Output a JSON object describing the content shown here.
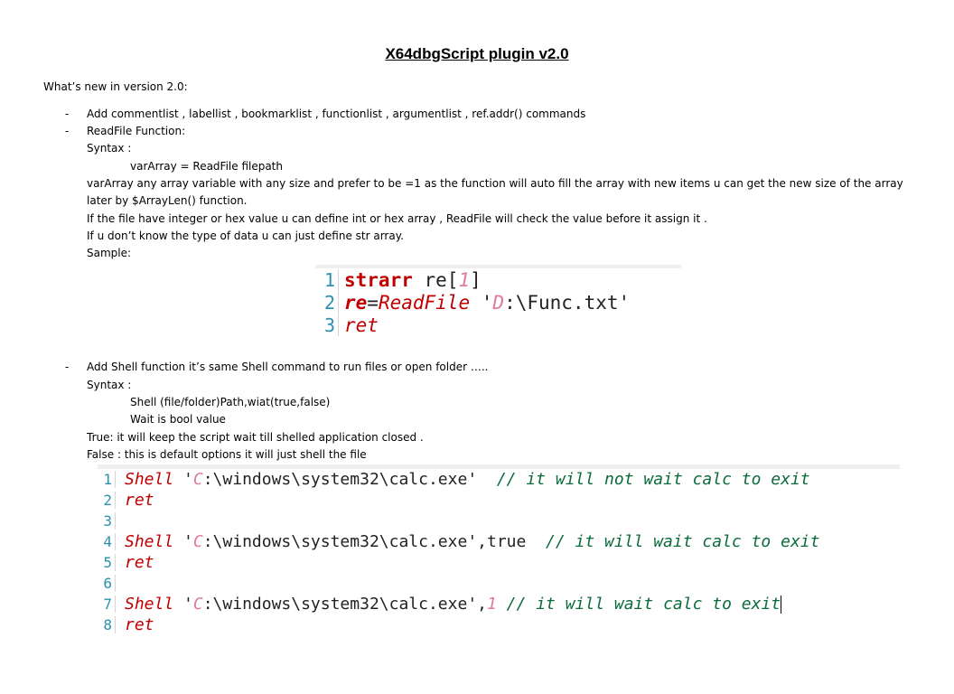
{
  "doc": {
    "title": "X64dbgScript plugin v2.0",
    "whats_new": "What’s new in version 2.0:",
    "bullet_marker": "-",
    "item1": "Add  commentlist , labellist , bookmarklist , functionlist , argumentlist , ref.addr() commands",
    "item2": "ReadFile Function:",
    "syntax_label": "Syntax :",
    "readfile_syntax": "varArray = ReadFile  filepath",
    "desc1": "varArray any array variable with any size and prefer to be =1 as the function will auto fill the array with new items u can get the new size of the array",
    "desc2": "later by $ArrayLen() function.",
    "desc3": "If the file have integer or hex value u can define int or hex array , ReadFile will check the value before it assign it .",
    "desc4": "If u don’t know the type of data u can just define str array.",
    "sample_label": "Sample:",
    "item3": "Add Shell function it’s same Shell command to run files or open folder …..",
    "syntax_label2": "Syntax :",
    "shell_syntax": "Shell (file/folder)Path,wiat(true,false)",
    "wait_desc": "Wait is bool value",
    "true_desc": "True: it will keep the script wait till shelled application closed .",
    "false_desc": "False : this is default options it will just shell the file"
  },
  "code1": {
    "ln1": "1",
    "ln2": "2",
    "ln3": "3",
    "l1_kw": "strarr",
    "l1_var": " re[",
    "l1_num": "1",
    "l1_end": "]",
    "l2_var": "re",
    "l2_eq": "=",
    "l2_fn": "ReadFile",
    "l2_q": " '",
    "l2_drive": "D",
    "l2_path": ":\\Func.txt'",
    "l3": "ret"
  },
  "code2": {
    "ln1": "1",
    "ln2": "2",
    "ln3": "3",
    "ln4": "4",
    "ln5": "5",
    "ln6": "6",
    "ln7": "7",
    "ln8": "8",
    "shell": "Shell",
    "q": " '",
    "drive": "C",
    "path": ":\\windows\\system32\\calc.exe'",
    "c1": "  // it will not wait calc to exit",
    "ret": "ret",
    "arg2": ",true",
    "c2": "  // it will wait calc to exit",
    "comma": ",",
    "arg3": "1",
    "c3": " // it will wait calc to exit"
  }
}
